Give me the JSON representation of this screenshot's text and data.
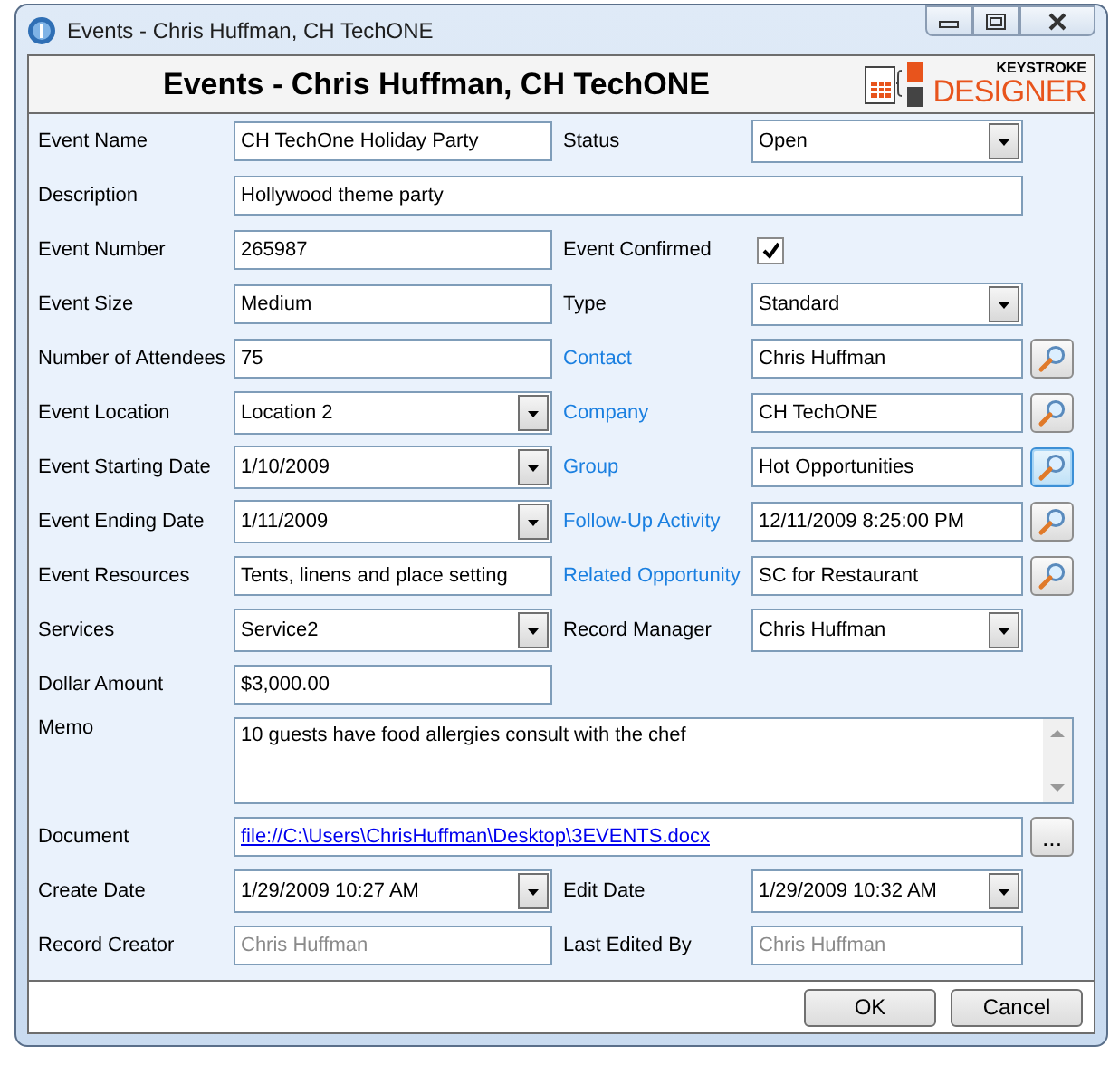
{
  "window": {
    "title": "Events - Chris Huffman, CH TechONE"
  },
  "header": {
    "title": "Events - Chris Huffman, CH TechONE",
    "logo_top": "KEYSTROKE",
    "logo_bottom": "DESIGNER"
  },
  "rows": [
    {
      "cells": [
        {
          "label": "Event Name",
          "link": false,
          "kind": "text",
          "value": "CH TechOne Holiday Party"
        },
        {
          "label": "Status",
          "link": false,
          "kind": "combo",
          "value": "Open"
        }
      ]
    },
    {
      "cells": [
        {
          "label": "Description",
          "link": false,
          "kind": "wide",
          "value": "Hollywood theme party"
        }
      ]
    },
    {
      "cells": [
        {
          "label": "Event Number",
          "link": false,
          "kind": "text",
          "value": "265987"
        },
        {
          "label": "Event Confirmed",
          "link": false,
          "kind": "check",
          "checked": true
        }
      ]
    },
    {
      "cells": [
        {
          "label": "Event Size",
          "link": false,
          "kind": "text",
          "value": "Medium"
        },
        {
          "label": "Type",
          "link": false,
          "kind": "combo",
          "value": "Standard"
        }
      ]
    },
    {
      "cells": [
        {
          "label": "Number of Attendees",
          "link": false,
          "kind": "text",
          "value": "75"
        },
        {
          "label": "Contact",
          "link": true,
          "kind": "lookup",
          "value": "Chris Huffman",
          "selected": false
        }
      ]
    },
    {
      "cells": [
        {
          "label": "Event Location",
          "link": false,
          "kind": "combo",
          "value": "Location 2"
        },
        {
          "label": "Company",
          "link": true,
          "kind": "lookup",
          "value": "CH TechONE",
          "selected": false
        }
      ]
    },
    {
      "cells": [
        {
          "label": "Event Starting Date",
          "link": false,
          "kind": "combo",
          "value": "1/10/2009"
        },
        {
          "label": "Group",
          "link": true,
          "kind": "lookup",
          "value": "Hot Opportunities",
          "selected": true
        }
      ]
    },
    {
      "cells": [
        {
          "label": "Event Ending Date",
          "link": false,
          "kind": "combo",
          "value": "1/11/2009"
        },
        {
          "label": "Follow-Up Activity",
          "link": true,
          "kind": "lookup",
          "value": "12/11/2009 8:25:00 PM",
          "selected": false
        }
      ]
    },
    {
      "cells": [
        {
          "label": "Event Resources",
          "link": false,
          "kind": "text",
          "value": "Tents, linens and place setting"
        },
        {
          "label": "Related Opportunity",
          "link": true,
          "kind": "lookup",
          "value": "SC for Restaurant",
          "selected": false
        }
      ]
    },
    {
      "cells": [
        {
          "label": "Services",
          "link": false,
          "kind": "combo",
          "value": "Service2"
        },
        {
          "label": "Record Manager",
          "link": false,
          "kind": "combo",
          "value": "Chris Huffman"
        }
      ]
    },
    {
      "cells": [
        {
          "label": "Dollar Amount",
          "link": false,
          "kind": "text",
          "value": "$3,000.00"
        }
      ]
    },
    {
      "cells": [
        {
          "label": "Memo",
          "link": false,
          "kind": "memo",
          "value": "10 guests have food allergies consult with the chef"
        }
      ]
    },
    {
      "cells": [
        {
          "label": "Document",
          "link": false,
          "kind": "file",
          "value": "file://C:\\Users\\ChrisHuffman\\Desktop\\3EVENTS.docx",
          "button": "..."
        }
      ]
    },
    {
      "cells": [
        {
          "label": "Create Date",
          "link": false,
          "kind": "combo",
          "value": "1/29/2009 10:27 AM"
        },
        {
          "label": "Edit Date",
          "link": false,
          "kind": "combo",
          "value": "1/29/2009 10:32 AM"
        }
      ]
    },
    {
      "cells": [
        {
          "label": "Record Creator",
          "link": false,
          "kind": "readonly",
          "value": "Chris Huffman"
        },
        {
          "label": "Last Edited By",
          "link": false,
          "kind": "readonly",
          "value": "Chris Huffman"
        }
      ]
    }
  ],
  "buttons": [
    "OK",
    "Cancel"
  ]
}
